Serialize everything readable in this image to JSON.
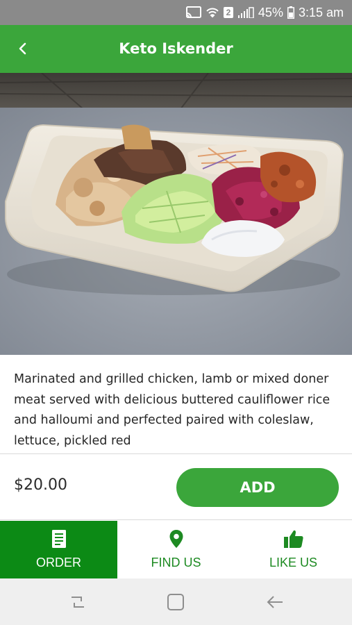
{
  "status_bar": {
    "sim_badge": "2",
    "battery": "45%",
    "time": "3:15 am"
  },
  "header": {
    "title": "Keto Iskender",
    "back_icon": "chevron-left-icon"
  },
  "product": {
    "description": "Marinated and grilled chicken, lamb or mixed doner meat served with delicious buttered cauliflower rice and halloumi and perfected paired with coleslaw, lettuce, pickled red",
    "price": "$20.00",
    "add_label": "ADD"
  },
  "tabs": [
    {
      "label": "ORDER",
      "icon": "menu-list-icon",
      "active": true
    },
    {
      "label": "FIND US",
      "icon": "location-pin-icon",
      "active": false
    },
    {
      "label": "LIKE US",
      "icon": "thumbs-up-icon",
      "active": false
    }
  ],
  "colors": {
    "brand_green": "#3ba63b",
    "active_tab": "#0c8a15",
    "tab_text": "#1d8a22"
  }
}
